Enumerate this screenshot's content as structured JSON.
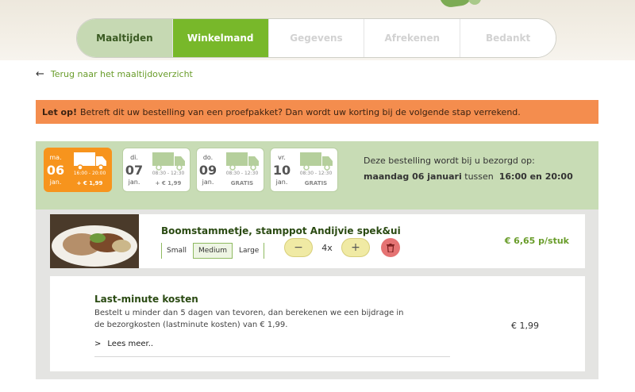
{
  "steps": [
    {
      "label": "Maaltijden",
      "state": "done"
    },
    {
      "label": "Winkelmand",
      "state": "active"
    },
    {
      "label": "Gegevens",
      "state": "todo"
    },
    {
      "label": "Afrekenen",
      "state": "todo"
    },
    {
      "label": "Bedankt",
      "state": "todo"
    }
  ],
  "back_link": {
    "label": "Terug naar het maaltijdoverzicht",
    "icon": "arrow-left-icon"
  },
  "alert": {
    "bold": "Let op!",
    "text": "Betreft dit uw bestelling van een proefpakket? Dan wordt uw korting bij de volgende stap verrekend."
  },
  "days": [
    {
      "dname": "ma.",
      "dnum": "06",
      "dmon": "jan.",
      "time": "16:00 - 20:00",
      "price": "+ € 1,99",
      "selected": true
    },
    {
      "dname": "di.",
      "dnum": "07",
      "dmon": "jan.",
      "time": "08:30 - 12:30",
      "price": "+ € 1,99",
      "selected": false
    },
    {
      "dname": "do.",
      "dnum": "09",
      "dmon": "jan.",
      "time": "08:30 - 12:30",
      "price": "GRATIS",
      "selected": false
    },
    {
      "dname": "vr.",
      "dnum": "10",
      "dmon": "jan.",
      "time": "08:30 - 12:30",
      "price": "GRATIS",
      "selected": false
    }
  ],
  "delivery": {
    "line1": "Deze bestelling wordt bij u bezorgd op:",
    "date": "maandag 06 januari",
    "between": "tussen",
    "window": "16:00 en 20:00"
  },
  "item": {
    "title": "Boomstammetje, stamppot Andijvie spek&ui",
    "sizes": [
      "Small",
      "Medium",
      "Large"
    ],
    "selected_size": "Medium",
    "minus": "−",
    "plus": "+",
    "qty": "4x",
    "unit_price": "€ 6,65 p/stuk"
  },
  "lastminute": {
    "title": "Last-minute kosten",
    "text": "Bestelt u minder dan 5 dagen van tevoren, dan berekenen we een bijdrage in de bezorgkosten (lastminute kosten) van € 1,99.",
    "more": "Lees meer..",
    "price": "€ 1,99"
  },
  "colors": {
    "accent_green": "#78b82a",
    "done_green": "#c6d9b3",
    "alert_orange": "#f48d4e",
    "selected_day": "#f7941d",
    "delete_red": "#e57373"
  }
}
